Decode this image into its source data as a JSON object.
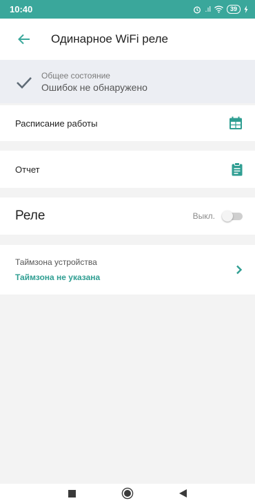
{
  "status_bar": {
    "time": "10:40",
    "signal_text": ".ıl",
    "battery": "39"
  },
  "app_bar": {
    "title": "Одинарное WiFi реле"
  },
  "status_card": {
    "label": "Общее состояние",
    "value": "Ошибок не обнаружено"
  },
  "menu": {
    "schedule_label": "Расписание работы",
    "report_label": "Отчет"
  },
  "relay": {
    "label": "Реле",
    "state_label": "Выкл.",
    "on": false
  },
  "timezone": {
    "label": "Таймзона устройства",
    "value": "Таймзона не указана"
  },
  "colors": {
    "accent": "#3aa79b",
    "link": "#2f9e92",
    "background": "#f3f3f3"
  }
}
